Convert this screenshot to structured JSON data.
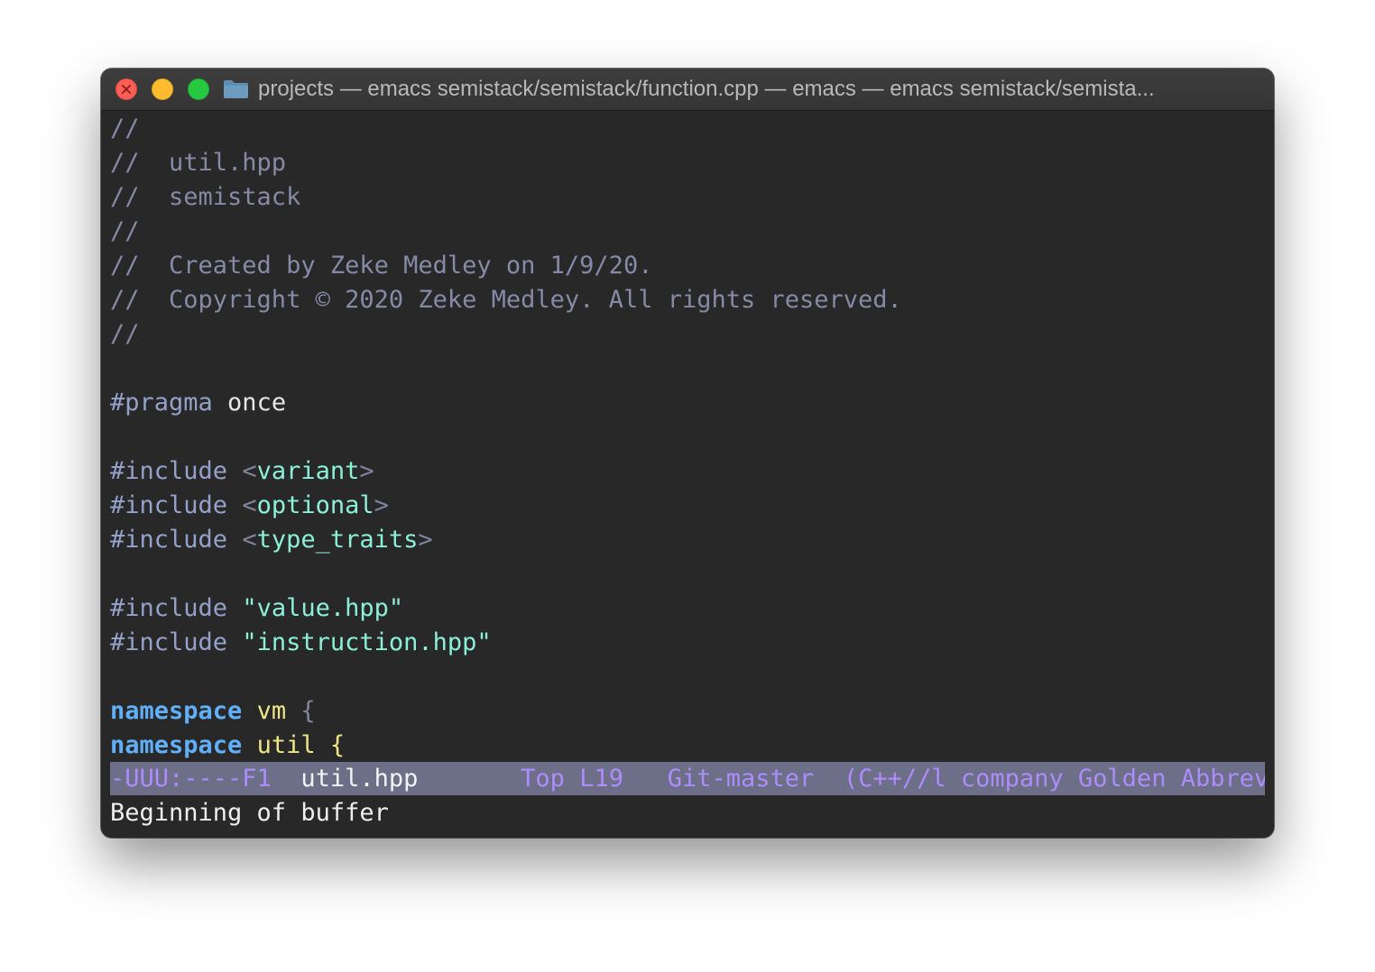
{
  "window": {
    "title": "projects — emacs semistack/semistack/function.cpp — emacs — emacs semistack/semista..."
  },
  "code_lines": [
    [
      {
        "t": "//",
        "c": "comment"
      }
    ],
    [
      {
        "t": "//  util.hpp",
        "c": "comment"
      }
    ],
    [
      {
        "t": "//  semistack",
        "c": "comment"
      }
    ],
    [
      {
        "t": "//",
        "c": "comment"
      }
    ],
    [
      {
        "t": "//  Created by Zeke Medley on 1/9/20.",
        "c": "comment"
      }
    ],
    [
      {
        "t": "//  Copyright © 2020 Zeke Medley. All rights reserved.",
        "c": "comment"
      }
    ],
    [
      {
        "t": "//",
        "c": "comment"
      }
    ],
    [],
    [
      {
        "t": "#pragma",
        "c": "pre"
      },
      {
        "t": " once",
        "c": "plain"
      }
    ],
    [],
    [
      {
        "t": "#include ",
        "c": "pre"
      },
      {
        "t": "<",
        "c": "dim"
      },
      {
        "t": "variant",
        "c": "str"
      },
      {
        "t": ">",
        "c": "dim"
      }
    ],
    [
      {
        "t": "#include ",
        "c": "pre"
      },
      {
        "t": "<",
        "c": "dim"
      },
      {
        "t": "optional",
        "c": "str"
      },
      {
        "t": ">",
        "c": "dim"
      }
    ],
    [
      {
        "t": "#include ",
        "c": "pre"
      },
      {
        "t": "<",
        "c": "dim"
      },
      {
        "t": "type_traits",
        "c": "str"
      },
      {
        "t": ">",
        "c": "dim"
      }
    ],
    [],
    [
      {
        "t": "#include ",
        "c": "pre"
      },
      {
        "t": "\"value.hpp\"",
        "c": "str"
      }
    ],
    [
      {
        "t": "#include ",
        "c": "pre"
      },
      {
        "t": "\"instruction.hpp\"",
        "c": "str"
      }
    ],
    [],
    [
      {
        "t": "namespace",
        "c": "kw"
      },
      {
        "t": " vm ",
        "c": "ns"
      },
      {
        "t": "{",
        "c": "brace"
      }
    ],
    [
      {
        "t": "namespace",
        "c": "kw"
      },
      {
        "t": " util ",
        "c": "ns"
      },
      {
        "t": "{",
        "c": "brace2"
      }
    ]
  ],
  "modeline": {
    "status": "-UUU:----F1",
    "buffer_name": "util.hpp",
    "position": "Top L19",
    "vc": "Git-master",
    "modes": "(C++//l company Golden Abbrev)"
  },
  "echo_area": "Beginning of buffer",
  "colors": {
    "background": "#282828",
    "comment": "#868aa6",
    "keyword": "#61aff9",
    "string": "#8bf0d7",
    "namespace_name": "#efe787",
    "modeline_bg": "#6c6f87",
    "modeline_fg": "#ad8cfc"
  },
  "icons": [
    "close-icon",
    "minimize-icon",
    "zoom-icon",
    "folder-icon"
  ]
}
